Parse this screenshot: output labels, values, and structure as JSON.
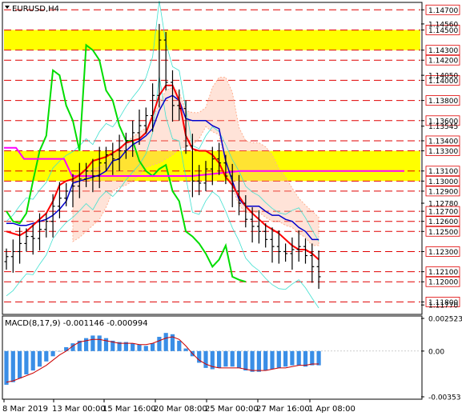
{
  "window": {
    "symbol_timeframe": "EURUSD,H4"
  },
  "indicator": {
    "macd_label": "MACD(8,17,9) -0.001146 -0.000994"
  },
  "colors": {
    "background": "#ffffff",
    "zone": "#ffff00",
    "resistance_line": "#e00000",
    "price_bar": "#000000",
    "ma_fast": "#ff0000",
    "ma_slow": "#0000cc",
    "cloud_line": "#00dd00",
    "magenta_line": "#ff00ff",
    "band": "#40e0d0",
    "cloud_fill": "#ffb090",
    "macd_hist": "#3a8ee6",
    "macd_signal": "#cc0000",
    "axis": "#000000",
    "tag_fill": "#ffffff"
  },
  "chart_data": [
    {
      "type": "line",
      "title": "EURUSD,H4",
      "xlabel": "",
      "ylabel": "",
      "ylim": [
        1.117,
        1.1475
      ],
      "grid": false,
      "x_tick_labels": [
        "8 Mar 2019",
        "13 Mar 00:00",
        "15 Mar 16:00",
        "20 Mar 08:00",
        "25 Mar 00:00",
        "27 Mar 16:00",
        "1 Apr 08:00"
      ],
      "highlight_zones": [
        {
          "from": 1.143,
          "to": 1.145
        },
        {
          "from": 1.13,
          "to": 1.133
        }
      ],
      "horizontal_levels": [
        1.147,
        1.145,
        1.143,
        1.142,
        1.14,
        1.138,
        1.136,
        1.134,
        1.133,
        1.131,
        1.13,
        1.129,
        1.127,
        1.126,
        1.125,
        1.123,
        1.121,
        1.12,
        1.118
      ],
      "price_labels": [
        "1.14700",
        "1.14500",
        "1.14300",
        "1.14200",
        "1.14000",
        "1.13800",
        "1.13600",
        "1.13400",
        "1.13300",
        "1.13100",
        "1.13000",
        "1.12900",
        "1.12700",
        "1.12600",
        "1.12500",
        "1.12300",
        "1.12100",
        "1.12000",
        "1.11800"
      ],
      "minor_price_labels": [
        "1.14560",
        "1.14050",
        "1.13545",
        "1.12780",
        "1.11770"
      ],
      "series": [
        {
          "values": [
            1.1225,
            1.123,
            1.1238,
            1.1245,
            1.1243,
            1.1252,
            1.126,
            1.1275,
            1.1283,
            1.129,
            1.1295,
            1.1302,
            1.131,
            1.1305,
            1.1318,
            1.1326,
            1.1322,
            1.133,
            1.134,
            1.1348,
            1.1355,
            1.1365,
            1.1385,
            1.144,
            1.1398,
            1.1375,
            1.1372,
            1.1335,
            1.13,
            1.1298,
            1.1312,
            1.1322,
            1.1318,
            1.1305,
            1.129,
            1.1278,
            1.1262,
            1.1255,
            1.125,
            1.1242,
            1.1235,
            1.123,
            1.1228,
            1.1232,
            1.1235,
            1.1226,
            1.1215,
            1.1205
          ]
        }
      ],
      "ma_fast": [
        1.125,
        1.1248,
        1.1246,
        1.125,
        1.1256,
        1.1262,
        1.1268,
        1.128,
        1.1296,
        1.13,
        1.1302,
        1.1306,
        1.1312,
        1.132,
        1.1322,
        1.1324,
        1.1328,
        1.1332,
        1.1338,
        1.134,
        1.1342,
        1.1348,
        1.1365,
        1.1385,
        1.1395,
        1.1395,
        1.138,
        1.1345,
        1.1332,
        1.133,
        1.133,
        1.1326,
        1.1318,
        1.1304,
        1.1296,
        1.1285,
        1.1275,
        1.1268,
        1.1262,
        1.1256,
        1.1252,
        1.1248,
        1.1242,
        1.1236,
        1.1232,
        1.1232,
        1.1228,
        1.1222
      ],
      "ma_slow": [
        1.1258,
        1.1258,
        1.1256,
        1.1256,
        1.1258,
        1.126,
        1.1262,
        1.1266,
        1.1272,
        1.128,
        1.1298,
        1.13,
        1.1302,
        1.1304,
        1.1306,
        1.131,
        1.132,
        1.1322,
        1.133,
        1.1336,
        1.134,
        1.1345,
        1.1352,
        1.137,
        1.1382,
        1.1385,
        1.138,
        1.1362,
        1.136,
        1.136,
        1.136,
        1.1355,
        1.1352,
        1.132,
        1.13,
        1.1282,
        1.1275,
        1.1275,
        1.1275,
        1.127,
        1.1266,
        1.1266,
        1.1262,
        1.126,
        1.1254,
        1.125,
        1.1242,
        1.1242
      ],
      "cloud_line": [
        1.127,
        1.126,
        1.1258,
        1.1268,
        1.13,
        1.133,
        1.1345,
        1.141,
        1.1405,
        1.1375,
        1.136,
        1.133,
        1.1435,
        1.143,
        1.142,
        1.139,
        1.138,
        1.1355,
        1.134,
        1.134,
        1.132,
        1.131,
        1.1305,
        1.1312,
        1.1316,
        1.129,
        1.128,
        1.125,
        1.1245,
        1.1238,
        1.1228,
        1.1215,
        1.1222,
        1.1236,
        1.1205,
        1.1202,
        1.12
      ]
    },
    {
      "type": "bar",
      "title": "MACD(8,17,9) -0.001146 -0.000994",
      "xlabel": "",
      "ylabel": "",
      "ylim": [
        -0.00353,
        0.002523
      ],
      "grid": false,
      "tick_labels": [
        "0.002523",
        "0.00",
        "-0.00353"
      ],
      "values": [
        -0.0026,
        -0.0024,
        -0.0021,
        -0.0018,
        -0.0015,
        -0.0012,
        -0.0008,
        -0.0004,
        0.0,
        0.0003,
        0.0006,
        0.0008,
        0.001,
        0.0012,
        0.0012,
        0.001,
        0.0008,
        0.0007,
        0.0007,
        0.0006,
        0.0005,
        0.0004,
        0.0006,
        0.0011,
        0.0014,
        0.0013,
        0.0008,
        0.0002,
        -0.0004,
        -0.0009,
        -0.0013,
        -0.0014,
        -0.0013,
        -0.0012,
        -0.0012,
        -0.0013,
        -0.0015,
        -0.0016,
        -0.0016,
        -0.0015,
        -0.0014,
        -0.0013,
        -0.0012,
        -0.0011,
        -0.0011,
        -0.0012,
        -0.0011,
        -0.0011
      ],
      "signal": [
        -0.0024,
        -0.0023,
        -0.0021,
        -0.0019,
        -0.0017,
        -0.0014,
        -0.0011,
        -0.0007,
        -0.0003,
        0.0,
        0.0004,
        0.0007,
        0.0008,
        0.0009,
        0.0009,
        0.0008,
        0.0007,
        0.0006,
        0.0006,
        0.0006,
        0.0005,
        0.0005,
        0.0006,
        0.0008,
        0.001,
        0.0011,
        0.0009,
        0.0004,
        -0.0002,
        -0.0007,
        -0.001,
        -0.0012,
        -0.0013,
        -0.0013,
        -0.0013,
        -0.0013,
        -0.0014,
        -0.0015,
        -0.0015,
        -0.0015,
        -0.0014,
        -0.0013,
        -0.0013,
        -0.0012,
        -0.0011,
        -0.0011,
        -0.001,
        -0.001
      ]
    }
  ]
}
